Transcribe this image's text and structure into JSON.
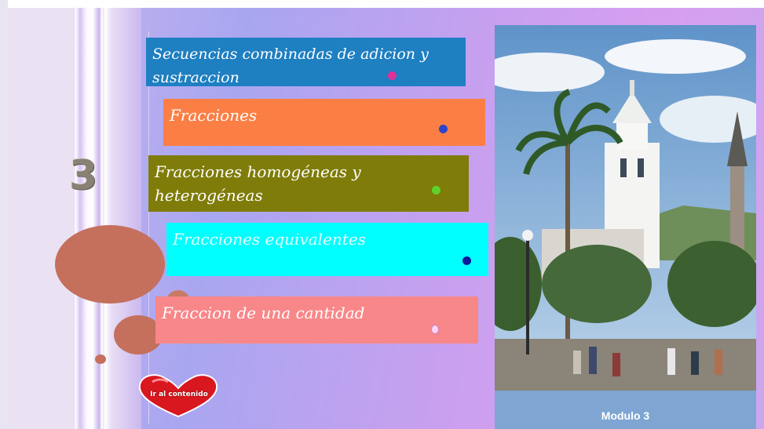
{
  "module": {
    "number": "3",
    "caption": "Modulo 3"
  },
  "menu": {
    "items": [
      {
        "label": "Secuencias combinadas de adicion y sustraccion",
        "color": "#1e7fc1"
      },
      {
        "label": "Fracciones",
        "color": "#fb7f45"
      },
      {
        "label": "Fracciones homogéneas y heterogéneas",
        "color": "#7f7c09"
      },
      {
        "label": "Fracciones equivalentes",
        "color": "#00ffff"
      },
      {
        "label": "Fraccion de una cantidad",
        "color": "#f88789"
      }
    ]
  },
  "home_button": {
    "label": "Ir al contenido",
    "icon": "heart-icon"
  },
  "photo": {
    "icon": "city-plaza-photo"
  }
}
